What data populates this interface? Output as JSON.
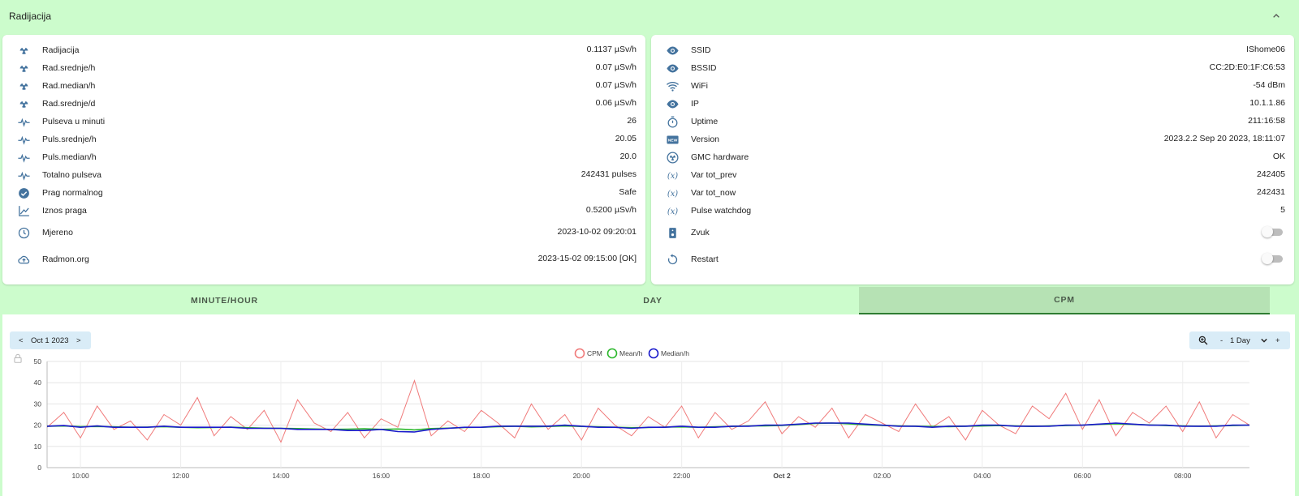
{
  "header": {
    "title": "Radijacija"
  },
  "left_panel": {
    "rows": [
      {
        "icon": "radiation-icon",
        "label": "Radijacija",
        "value": "0.1137 µSv/h"
      },
      {
        "icon": "radiation-icon",
        "label": "Rad.srednje/h",
        "value": "0.07 µSv/h"
      },
      {
        "icon": "radiation-icon",
        "label": "Rad.median/h",
        "value": "0.07 µSv/h"
      },
      {
        "icon": "radiation-icon",
        "label": "Rad.srednje/d",
        "value": "0.06 µSv/h"
      },
      {
        "icon": "pulse-icon",
        "label": "Pulseva u minuti",
        "value": "26"
      },
      {
        "icon": "pulse-icon",
        "label": "Puls.srednje/h",
        "value": "20.05"
      },
      {
        "icon": "pulse-icon",
        "label": "Puls.median/h",
        "value": "20.0"
      },
      {
        "icon": "pulse-icon",
        "label": "Totalno pulseva",
        "value": "242431 pulses"
      },
      {
        "icon": "check-circle-icon",
        "label": "Prag normalnog",
        "value": "Safe"
      },
      {
        "icon": "chart-line-icon",
        "label": "Iznos praga",
        "value": "0.5200 µSv/h"
      },
      {
        "icon": "clock-icon",
        "label": "Mjereno",
        "value": "2023-10-02 09:20:01"
      },
      {
        "icon": "cloud-upload-icon",
        "label": "Radmon.org",
        "value": "2023-15-02 09:15:00 [OK]"
      }
    ]
  },
  "right_panel": {
    "rows": [
      {
        "icon": "eye-icon",
        "label": "SSID",
        "value": "IShome06"
      },
      {
        "icon": "eye-icon",
        "label": "BSSID",
        "value": "CC:2D:E0:1F:C6:53"
      },
      {
        "icon": "wifi-icon",
        "label": "WiFi",
        "value": "-54 dBm"
      },
      {
        "icon": "eye-icon",
        "label": "IP",
        "value": "10.1.1.86"
      },
      {
        "icon": "timer-icon",
        "label": "Uptime",
        "value": "211:16:58"
      },
      {
        "icon": "new-box-icon",
        "label": "Version",
        "value": "2023.2.2 Sep 20 2023, 18:11:07"
      },
      {
        "icon": "radiation-circle-icon",
        "label": "GMC hardware",
        "value": "OK"
      },
      {
        "icon": "variable-icon",
        "label": "Var tot_prev",
        "value": "242405"
      },
      {
        "icon": "variable-icon",
        "label": "Var tot_now",
        "value": "242431"
      },
      {
        "icon": "variable-icon",
        "label": "Pulse watchdog",
        "value": "5"
      },
      {
        "icon": "speaker-icon",
        "label": "Zvuk",
        "value": ""
      },
      {
        "icon": "restart-icon",
        "label": "Restart",
        "value": ""
      }
    ],
    "toggles": {
      "zvuk": "off",
      "restart": "off"
    }
  },
  "tabs": [
    {
      "label": "MINUTE/HOUR",
      "active": false
    },
    {
      "label": "DAY",
      "active": false
    },
    {
      "label": "CPM",
      "active": true
    }
  ],
  "date_nav": {
    "prev": "<",
    "date": "Oct 1 2023",
    "next": ">"
  },
  "zoom_nav": {
    "minus": "-",
    "period": "1 Day",
    "plus": "+"
  },
  "colors": {
    "cpm": "#f07a7a",
    "mean": "#2eb82e",
    "median": "#1a1acc",
    "accent": "#44739e"
  },
  "chart_data": {
    "type": "line",
    "legend": [
      "CPM",
      "Mean/h",
      "Median/h"
    ],
    "ylim": [
      0,
      50
    ],
    "yticks": [
      "0",
      "10",
      "20",
      "30",
      "40",
      "50"
    ],
    "xticks": [
      "10:00",
      "12:00",
      "14:00",
      "16:00",
      "18:00",
      "20:00",
      "22:00",
      "Oct 2",
      "02:00",
      "04:00",
      "06:00",
      "08:00"
    ],
    "x": [
      "09:20",
      "09:40",
      "10:00",
      "10:20",
      "10:40",
      "11:00",
      "11:20",
      "11:40",
      "12:00",
      "12:20",
      "12:40",
      "13:00",
      "13:20",
      "13:40",
      "14:00",
      "14:20",
      "14:40",
      "15:00",
      "15:20",
      "15:40",
      "16:00",
      "16:20",
      "16:40",
      "17:00",
      "17:20",
      "17:40",
      "18:00",
      "18:20",
      "18:40",
      "19:00",
      "19:20",
      "19:40",
      "20:00",
      "20:20",
      "20:40",
      "21:00",
      "21:20",
      "21:40",
      "22:00",
      "22:20",
      "22:40",
      "23:00",
      "23:20",
      "23:40",
      "00:00",
      "00:20",
      "00:40",
      "01:00",
      "01:20",
      "01:40",
      "02:00",
      "02:20",
      "02:40",
      "03:00",
      "03:20",
      "03:40",
      "04:00",
      "04:20",
      "04:40",
      "05:00",
      "05:20",
      "05:40",
      "06:00",
      "06:20",
      "06:40",
      "07:00",
      "07:20",
      "07:40",
      "08:00",
      "08:20",
      "08:40",
      "09:00",
      "09:20"
    ],
    "series": [
      {
        "name": "CPM",
        "values": [
          19,
          26,
          14,
          29,
          18,
          22,
          13,
          25,
          20,
          33,
          15,
          24,
          18,
          27,
          12,
          32,
          21,
          17,
          26,
          14,
          23,
          19,
          41,
          15,
          22,
          17,
          27,
          21,
          14,
          30,
          18,
          25,
          13,
          28,
          20,
          15,
          24,
          19,
          29,
          14,
          26,
          18,
          22,
          31,
          16,
          24,
          19,
          28,
          14,
          25,
          21,
          17,
          30,
          19,
          24,
          13,
          27,
          20,
          16,
          29,
          23,
          35,
          18,
          32,
          15,
          26,
          21,
          29,
          17,
          31,
          14,
          25,
          20
        ]
      },
      {
        "name": "Mean/h",
        "values": [
          19.5,
          19.6,
          19.3,
          19.4,
          19.2,
          19.0,
          19.1,
          19.3,
          19.0,
          18.8,
          18.9,
          19.1,
          18.8,
          18.6,
          18.5,
          18.4,
          18.2,
          18.0,
          18.1,
          18.3,
          18.0,
          18.2,
          17.8,
          18.4,
          18.6,
          18.9,
          19.0,
          19.3,
          19.5,
          19.2,
          19.4,
          19.6,
          19.4,
          19.2,
          19.0,
          18.8,
          18.9,
          19.1,
          19.2,
          19.0,
          19.2,
          19.4,
          19.6,
          19.7,
          19.9,
          20.3,
          20.8,
          21.0,
          20.6,
          20.2,
          19.9,
          19.6,
          19.5,
          19.4,
          19.3,
          19.5,
          19.6,
          19.8,
          19.6,
          19.4,
          19.6,
          19.8,
          20.0,
          20.4,
          20.6,
          20.4,
          20.1,
          19.8,
          19.6,
          19.5,
          19.6,
          19.8,
          20.0
        ]
      },
      {
        "name": "Median/h",
        "values": [
          19.5,
          19.8,
          19.0,
          19.6,
          19.0,
          19.0,
          19.0,
          19.5,
          19.0,
          19.0,
          19.0,
          19.0,
          18.5,
          18.5,
          18.5,
          18.0,
          18.0,
          18.0,
          17.5,
          17.5,
          18.0,
          17.0,
          16.8,
          18.0,
          18.5,
          19.0,
          19.0,
          19.5,
          19.5,
          19.5,
          19.5,
          20.0,
          19.5,
          19.0,
          19.0,
          18.5,
          19.0,
          19.0,
          19.5,
          19.0,
          19.0,
          19.5,
          19.5,
          20.0,
          20.0,
          20.5,
          21.0,
          21.0,
          21.0,
          20.5,
          20.0,
          19.5,
          19.5,
          19.0,
          19.5,
          19.5,
          20.0,
          20.0,
          19.5,
          19.5,
          19.5,
          20.0,
          20.0,
          20.5,
          21.0,
          20.5,
          20.0,
          20.0,
          19.5,
          19.5,
          19.5,
          20.0,
          20.0
        ]
      }
    ]
  }
}
